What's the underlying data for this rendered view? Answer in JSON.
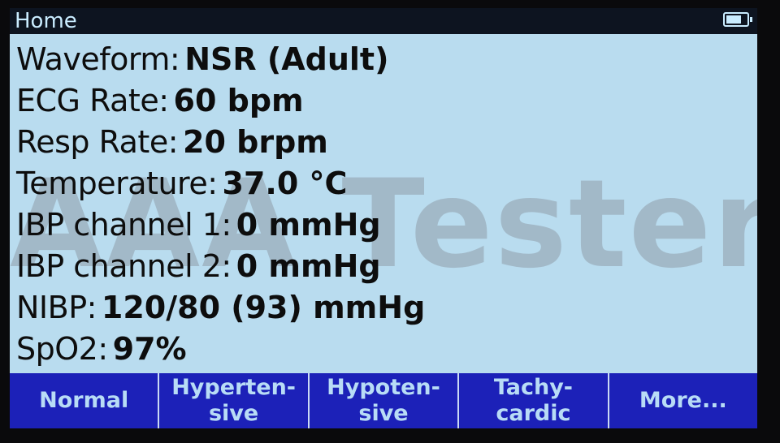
{
  "header": {
    "title": "Home",
    "battery_icon": "battery-icon",
    "battery_level": 0.8
  },
  "parameters": [
    {
      "label": "Waveform:",
      "value": "NSR (Adult)"
    },
    {
      "label": "ECG Rate:",
      "value": "60 bpm"
    },
    {
      "label": "Resp Rate:",
      "value": "20 brpm"
    },
    {
      "label": "Temperature:",
      "value": "37.0 °C"
    },
    {
      "label": "IBP channel 1:",
      "value": "0 mmHg"
    },
    {
      "label": "IBP channel 2:",
      "value": "0 mmHg"
    },
    {
      "label": "NIBP:",
      "value": "120/80 (93) mmHg"
    },
    {
      "label": "SpO2:",
      "value": "97%"
    }
  ],
  "watermark": "AAA Testers",
  "softkeys": [
    {
      "label": "Normal"
    },
    {
      "label": "Hyperten-\nsive"
    },
    {
      "label": "Hypoten-\nsive"
    },
    {
      "label": "Tachy-\ncardic"
    },
    {
      "label": "More..."
    }
  ],
  "colors": {
    "screen_bg": "#b9dcef",
    "titlebar_bg": "#0d1420",
    "softkey_bg": "#1c21b8",
    "softkey_text": "#b8dcf6"
  }
}
